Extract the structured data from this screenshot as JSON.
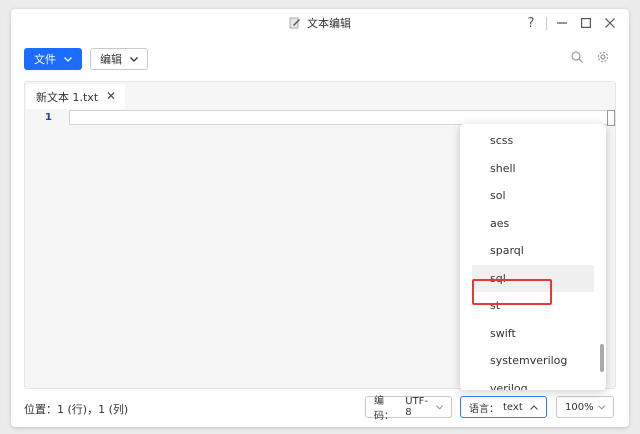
{
  "window": {
    "title": "文本编辑"
  },
  "controls": {
    "help": "?",
    "minimize": "—",
    "maximize": "☐",
    "close": "✕"
  },
  "toolbar": {
    "file_label": "文件",
    "edit_label": "编辑"
  },
  "tab": {
    "name": "新文本 1.txt",
    "close": "✕"
  },
  "editor": {
    "line_number": "1"
  },
  "status": {
    "position": "位置：1 (行)，1 (列)",
    "encoding_label": "编码：",
    "encoding_value": "UTF-8",
    "language_label": "语言：",
    "language_value": "text",
    "zoom": "100%"
  },
  "language_menu": {
    "items": [
      "scss",
      "shell",
      "sol",
      "aes",
      "sparql",
      "sql",
      "st",
      "swift",
      "systemverilog"
    ],
    "partial_item": "verilog",
    "highlighted": "sql"
  },
  "colors": {
    "accent": "#1a6dff",
    "highlight_border": "#e53935"
  }
}
